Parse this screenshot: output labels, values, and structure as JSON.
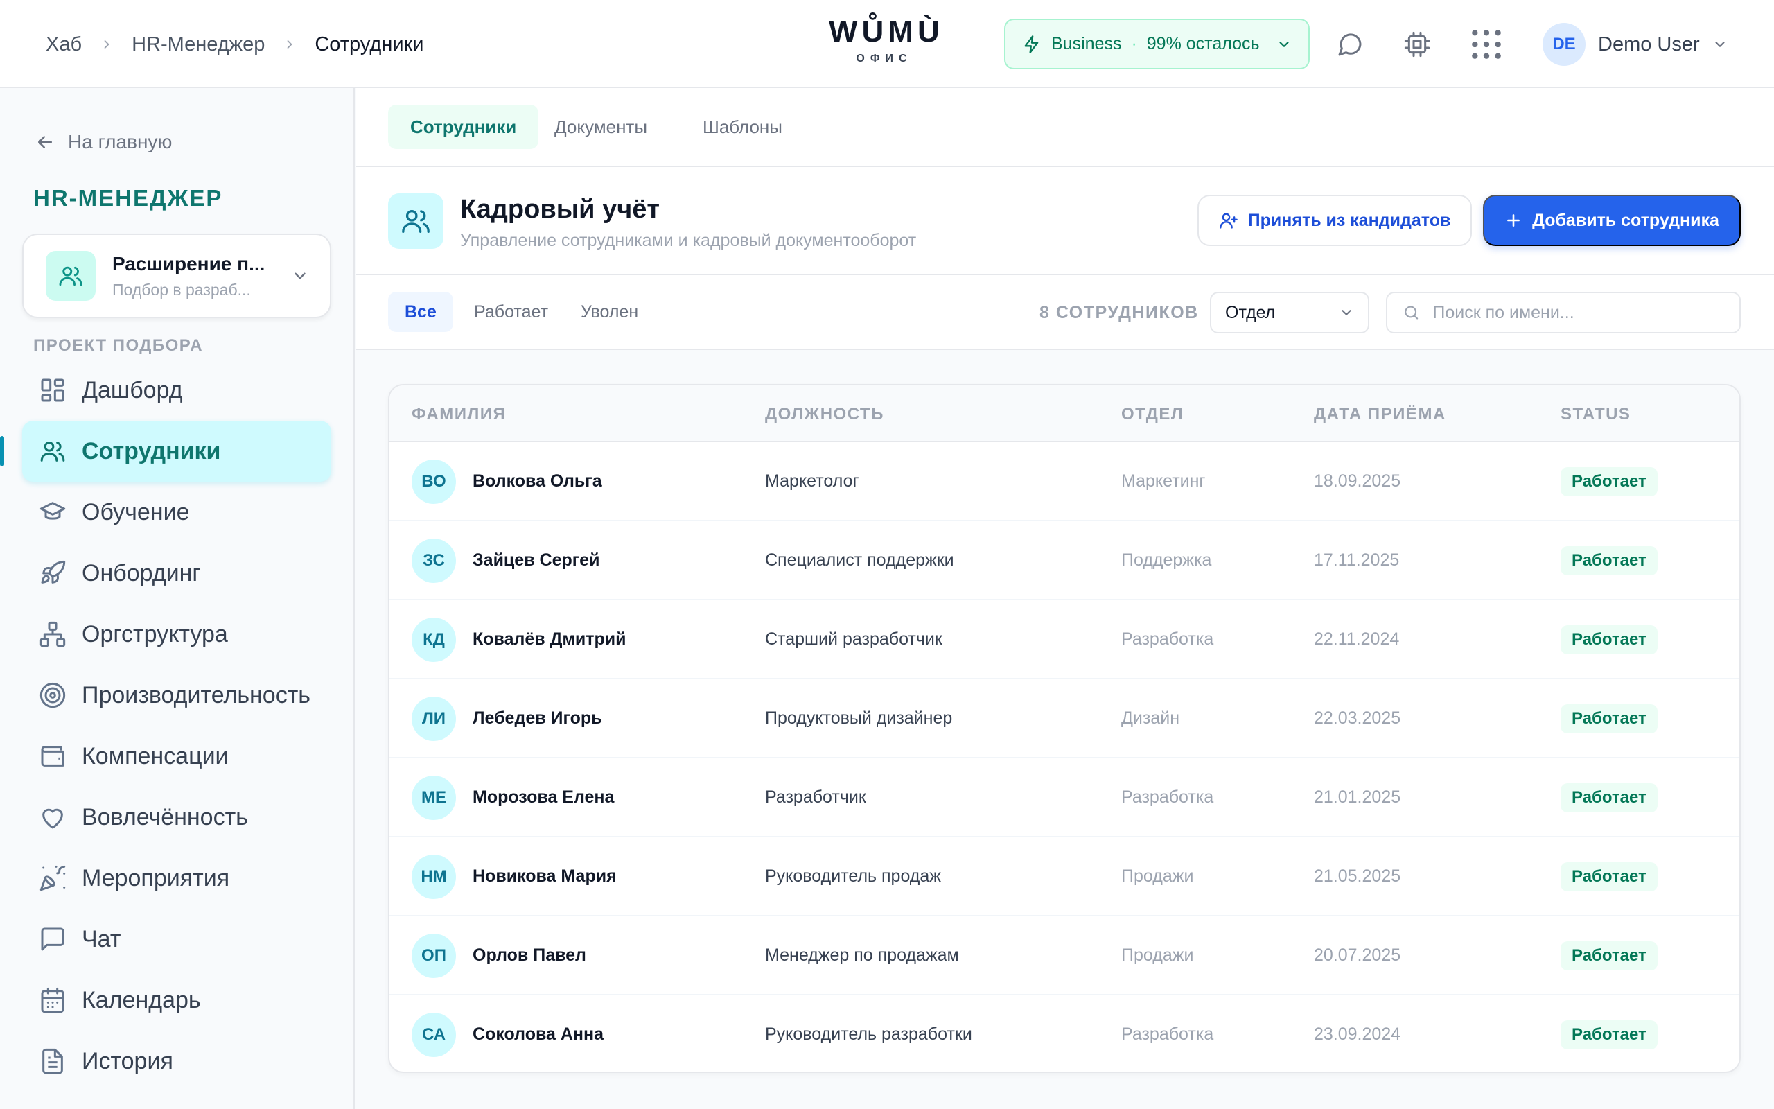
{
  "breadcrumb": {
    "items": [
      "Хаб",
      "HR-Менеджер",
      "Сотрудники"
    ]
  },
  "logo": {
    "main": "WŮMÙ",
    "sub": "ОФИС"
  },
  "plan": {
    "name": "Business",
    "separator": "·",
    "remaining": "99% осталось"
  },
  "user": {
    "initials": "DE",
    "name": "Demo User"
  },
  "sidebar": {
    "back_label": "На главную",
    "title": "HR-МЕНЕДЖЕР",
    "project": {
      "title": "Расширение п...",
      "subtitle": "Подбор в разраб..."
    },
    "section_label": "ПРОЕКТ ПОДБОРА",
    "items": [
      {
        "label": "Дашборд",
        "icon": "dashboard-icon"
      },
      {
        "label": "Сотрудники",
        "icon": "users-icon",
        "active": true
      },
      {
        "label": "Обучение",
        "icon": "graduation-cap-icon"
      },
      {
        "label": "Онбординг",
        "icon": "rocket-icon"
      },
      {
        "label": "Оргструктура",
        "icon": "org-chart-icon"
      },
      {
        "label": "Производительность",
        "icon": "target-icon"
      },
      {
        "label": "Компенсации",
        "icon": "wallet-icon"
      },
      {
        "label": "Вовлечённость",
        "icon": "heart-icon"
      },
      {
        "label": "Мероприятия",
        "icon": "party-popper-icon"
      },
      {
        "label": "Чат",
        "icon": "chat-icon"
      },
      {
        "label": "Календарь",
        "icon": "calendar-icon"
      },
      {
        "label": "История",
        "icon": "document-icon"
      }
    ]
  },
  "tabs": [
    "Сотрудники",
    "Документы",
    "Шаблоны"
  ],
  "page": {
    "title": "Кадровый учёт",
    "subtitle": "Управление сотрудниками и кадровый документооборот",
    "accept_button": "Принять из кандидатов",
    "add_button": "Добавить сотрудника"
  },
  "filters": {
    "chips": [
      "Все",
      "Работает",
      "Уволен"
    ],
    "count": "8 СОТРУДНИКОВ",
    "department": "Отдел",
    "search_placeholder": "Поиск по имени..."
  },
  "table": {
    "headers": [
      "ФАМИЛИЯ",
      "ДОЛЖНОСТЬ",
      "ОТДЕЛ",
      "ДАТА ПРИЁМА",
      "STATUS"
    ],
    "rows": [
      {
        "initials": "ВО",
        "name": "Волкова Ольга",
        "position": "Маркетолог",
        "department": "Маркетинг",
        "date": "18.09.2025",
        "status": "Работает"
      },
      {
        "initials": "ЗС",
        "name": "Зайцев Сергей",
        "position": "Специалист поддержки",
        "department": "Поддержка",
        "date": "17.11.2025",
        "status": "Работает"
      },
      {
        "initials": "КД",
        "name": "Ковалёв Дмитрий",
        "position": "Старший разработчик",
        "department": "Разработка",
        "date": "22.11.2024",
        "status": "Работает"
      },
      {
        "initials": "ЛИ",
        "name": "Лебедев Игорь",
        "position": "Продуктовый дизайнер",
        "department": "Дизайн",
        "date": "22.03.2025",
        "status": "Работает"
      },
      {
        "initials": "МЕ",
        "name": "Морозова Елена",
        "position": "Разработчик",
        "department": "Разработка",
        "date": "21.01.2025",
        "status": "Работает"
      },
      {
        "initials": "НМ",
        "name": "Новикова Мария",
        "position": "Руководитель продаж",
        "department": "Продажи",
        "date": "21.05.2025",
        "status": "Работает"
      },
      {
        "initials": "ОП",
        "name": "Орлов Павел",
        "position": "Менеджер по продажам",
        "department": "Продажи",
        "date": "20.07.2025",
        "status": "Работает"
      },
      {
        "initials": "СА",
        "name": "Соколова Анна",
        "position": "Руководитель разработки",
        "department": "Разработка",
        "date": "23.09.2024",
        "status": "Работает"
      }
    ]
  },
  "colors": {
    "accent": "#0f766e",
    "primary": "#2563eb",
    "status_active": "#047857"
  }
}
